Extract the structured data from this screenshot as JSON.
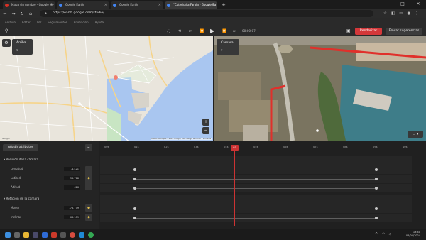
{
  "browser": {
    "tabs": [
      {
        "title": "Mapa sin nombre - Google My",
        "active": false
      },
      {
        "title": "Google Earth",
        "active": false
      },
      {
        "title": "Google Earth",
        "active": false
      },
      {
        "title": "\"Catedral a Farola - Google Ea",
        "active": true
      }
    ],
    "new_tab": "+",
    "url": "https://earth.google.com/studio/",
    "window_controls": [
      "–",
      "□",
      "✕"
    ]
  },
  "menu": [
    "Archivo",
    "Editar",
    "Ver",
    "Seguimientos",
    "Animación",
    "Ayuda"
  ],
  "controls": {
    "timecode": "00:00:07",
    "render_label": "Renderizar",
    "send_label": "Enviar sugerencias"
  },
  "map_view": {
    "view_dropdown": "Arriba",
    "attribution": "Datos de mapas ©2024 Google, Inst. Geogr. Nacional · Términos",
    "zoom_in": "+",
    "zoom_out": "−",
    "colors": {
      "water": "#a9c6f0",
      "land": "#e9e5dc",
      "park": "#c8e5c3",
      "road": "#f6d48a",
      "route": "#ffffff",
      "camera": "#f08070"
    }
  },
  "sat_view": {
    "view_dropdown": "Cámara",
    "colors": {
      "route": "#e0302b",
      "sea": "#3e7d89"
    }
  },
  "timeline": {
    "add_attributes_label": "Añadir atributos",
    "ruler_ticks": [
      "00s",
      "01s",
      "02s",
      "03s",
      "04s",
      "05s",
      "06s",
      "07s",
      "08s",
      "09s",
      "10s"
    ],
    "playhead_label": "07",
    "sections": [
      {
        "title": "Posición de la cámara",
        "properties": [
          {
            "label": "Longitud",
            "value": "-4.421"
          },
          {
            "label": "Latitud",
            "value": "36.718"
          },
          {
            "label": "Altitud",
            "value": "426"
          }
        ]
      },
      {
        "title": "Rotación de la cámara",
        "properties": [
          {
            "label": "Mover",
            "value": "-78.779"
          },
          {
            "label": "Inclinar",
            "value": "66.109"
          }
        ]
      }
    ]
  },
  "taskbar": {
    "time": "13:40",
    "date": "06/04/2024"
  }
}
